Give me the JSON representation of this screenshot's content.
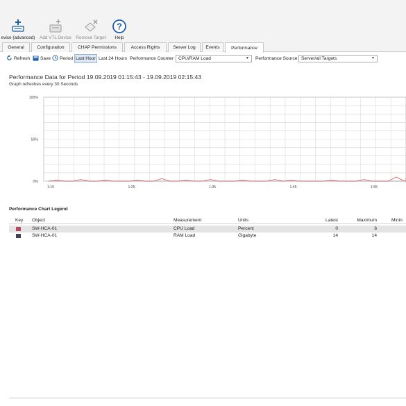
{
  "ribbon": {
    "buttons": [
      {
        "label": "evice (advanced)",
        "icon": "add-device-icon",
        "disabled": false
      },
      {
        "label": "Add VTL Device",
        "icon": "add-vtl-device-icon",
        "disabled": true
      },
      {
        "label": "Remove Target",
        "icon": "remove-target-icon",
        "disabled": true
      },
      {
        "label": "Help",
        "icon": "help-icon",
        "disabled": false
      }
    ]
  },
  "tabs": [
    "General",
    "Configuration",
    "CHAP Permissions",
    "Access Rights",
    "Server Log",
    "Events",
    "Performance"
  ],
  "active_tab": "Performance",
  "toolbar": {
    "refresh": "Refresh",
    "save": "Save",
    "period": "Period",
    "last_hour": "Last Hour",
    "last_24": "Last 24 Hours",
    "counter_label": "Performance Counter",
    "counter_value": "CPU/RAM Load",
    "source_label": "Performance Source",
    "source_value": "Server/all Targets"
  },
  "perf": {
    "title": "Performance Data for Period 19.09.2019 01:15:43 - 19.09.2019 02:15:43",
    "subtitle": "Graph refreshes every 30 Seconds"
  },
  "chart_data": {
    "type": "line",
    "y_ticks": [
      "100%",
      "50%",
      "0%"
    ],
    "x_ticks": [
      "1:15",
      "1:25",
      "1:35",
      "1:45",
      "1:55"
    ],
    "ylim": [
      0,
      100
    ],
    "grid": true,
    "series": [
      {
        "name": "SW-HCA-01",
        "color": "#d9534f",
        "x": [
          0,
          1,
          2,
          3,
          4,
          5,
          6,
          7,
          8,
          9,
          10,
          11,
          12,
          13,
          14,
          15,
          16,
          17,
          18,
          19,
          20,
          21,
          22,
          23,
          24,
          25,
          26,
          27,
          28,
          29,
          30,
          31,
          32,
          33,
          34,
          35,
          36,
          37,
          38,
          39,
          40,
          41,
          42,
          43,
          44,
          45,
          46,
          47,
          48,
          49,
          50,
          51,
          52,
          53,
          54,
          55,
          56,
          57,
          58,
          59,
          60
        ],
        "values": [
          0,
          1,
          0,
          0,
          2,
          0,
          0,
          1,
          0,
          0,
          0,
          1,
          0,
          0,
          3,
          0,
          0,
          1,
          0,
          0,
          2,
          0,
          0,
          0,
          1,
          0,
          0,
          0,
          2,
          0,
          1,
          0,
          0,
          0,
          0,
          1,
          0,
          0,
          0,
          2,
          0,
          0,
          0,
          5,
          0,
          0,
          1,
          0,
          0,
          0,
          4,
          0,
          0,
          1,
          0,
          0,
          2,
          0,
          0,
          1,
          0
        ]
      },
      {
        "name": "SW-HCA-01",
        "color": "#555566",
        "x": [
          0,
          60
        ],
        "values": [
          0,
          0
        ]
      }
    ]
  },
  "legend": {
    "title": "Performance Chart Legend",
    "headers": {
      "key": "Key",
      "object": "Object",
      "measurement": "Measurement",
      "units": "Units",
      "latest": "Latest",
      "maximum": "Maximum",
      "minimum": "Minin"
    },
    "rows": [
      {
        "color": "#b5485a",
        "object": "SW-HCA-01",
        "measurement": "CPU Load",
        "units": "Percent",
        "latest": "0",
        "maximum": "6"
      },
      {
        "color": "#3f4159",
        "object": "SW-HCA-01",
        "measurement": "RAM Load",
        "units": "Gigabyte",
        "latest": "14",
        "maximum": "14"
      }
    ]
  }
}
